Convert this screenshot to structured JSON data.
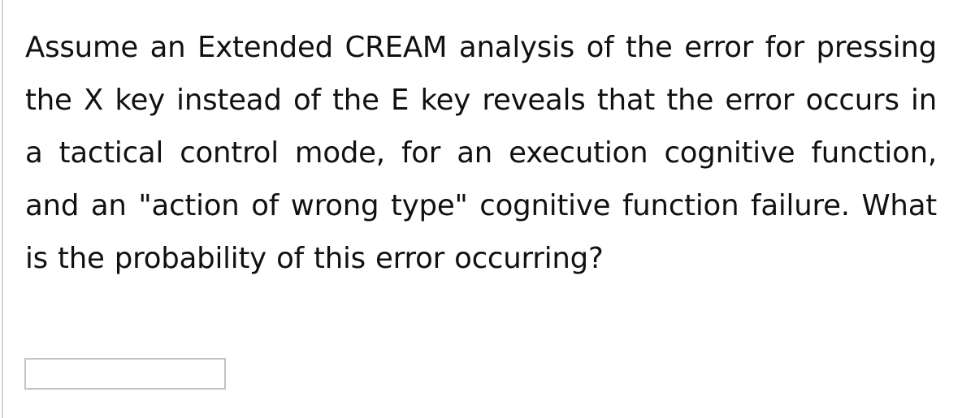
{
  "question": {
    "text": "Assume an Extended CREAM analysis of the error for pressing the X key instead of the E key reveals that the error occurs in a tactical control mode, for an execution cognitive function, and an \"action of wrong type\" cognitive function failure. What is the probability of this error occurring?"
  },
  "answer": {
    "value": "",
    "placeholder": ""
  }
}
